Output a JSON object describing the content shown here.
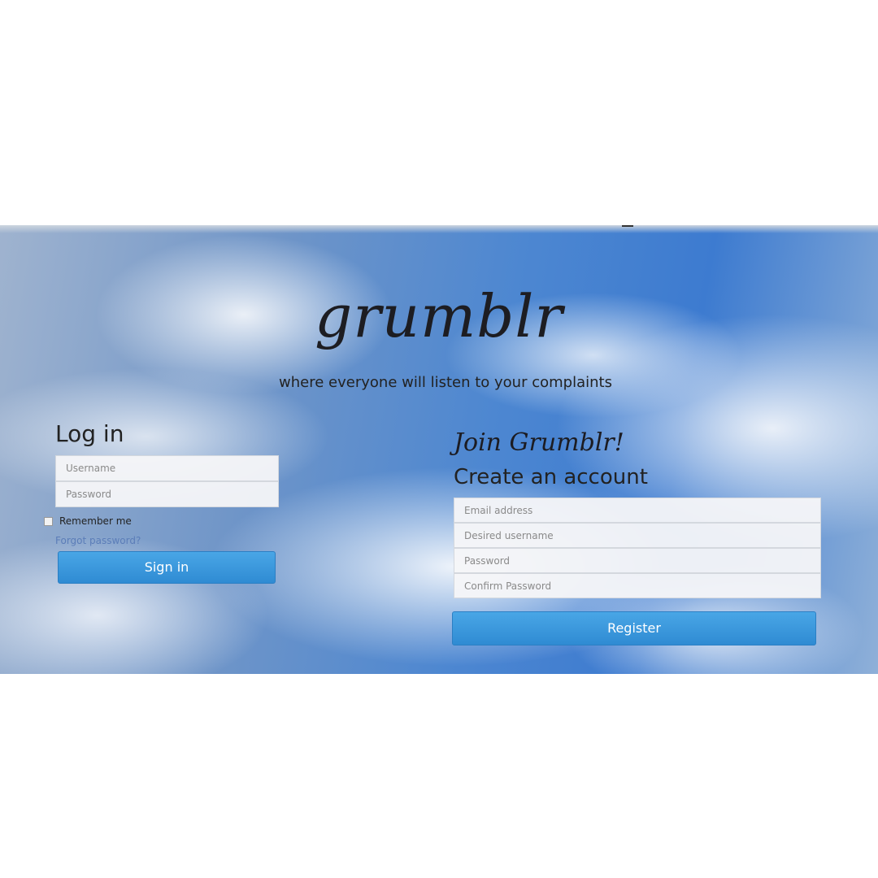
{
  "brand": {
    "logo_text": "grumblr",
    "tagline": "where everyone will listen to your complaints"
  },
  "login": {
    "heading": "Log in",
    "username_placeholder": "Username",
    "password_placeholder": "Password",
    "remember_label": "Remember me",
    "forgot_label": "Forgot password?",
    "signin_label": "Sign in"
  },
  "register": {
    "join_heading": "Join Grumblr!",
    "create_heading": "Create an account",
    "email_placeholder": "Email address",
    "username_placeholder": "Desired username",
    "password_placeholder": "Password",
    "confirm_placeholder": "Confirm Password",
    "register_label": "Register"
  },
  "colors": {
    "button": "#3391d6",
    "link": "#5b7db8",
    "sky": "#4d87d1"
  }
}
